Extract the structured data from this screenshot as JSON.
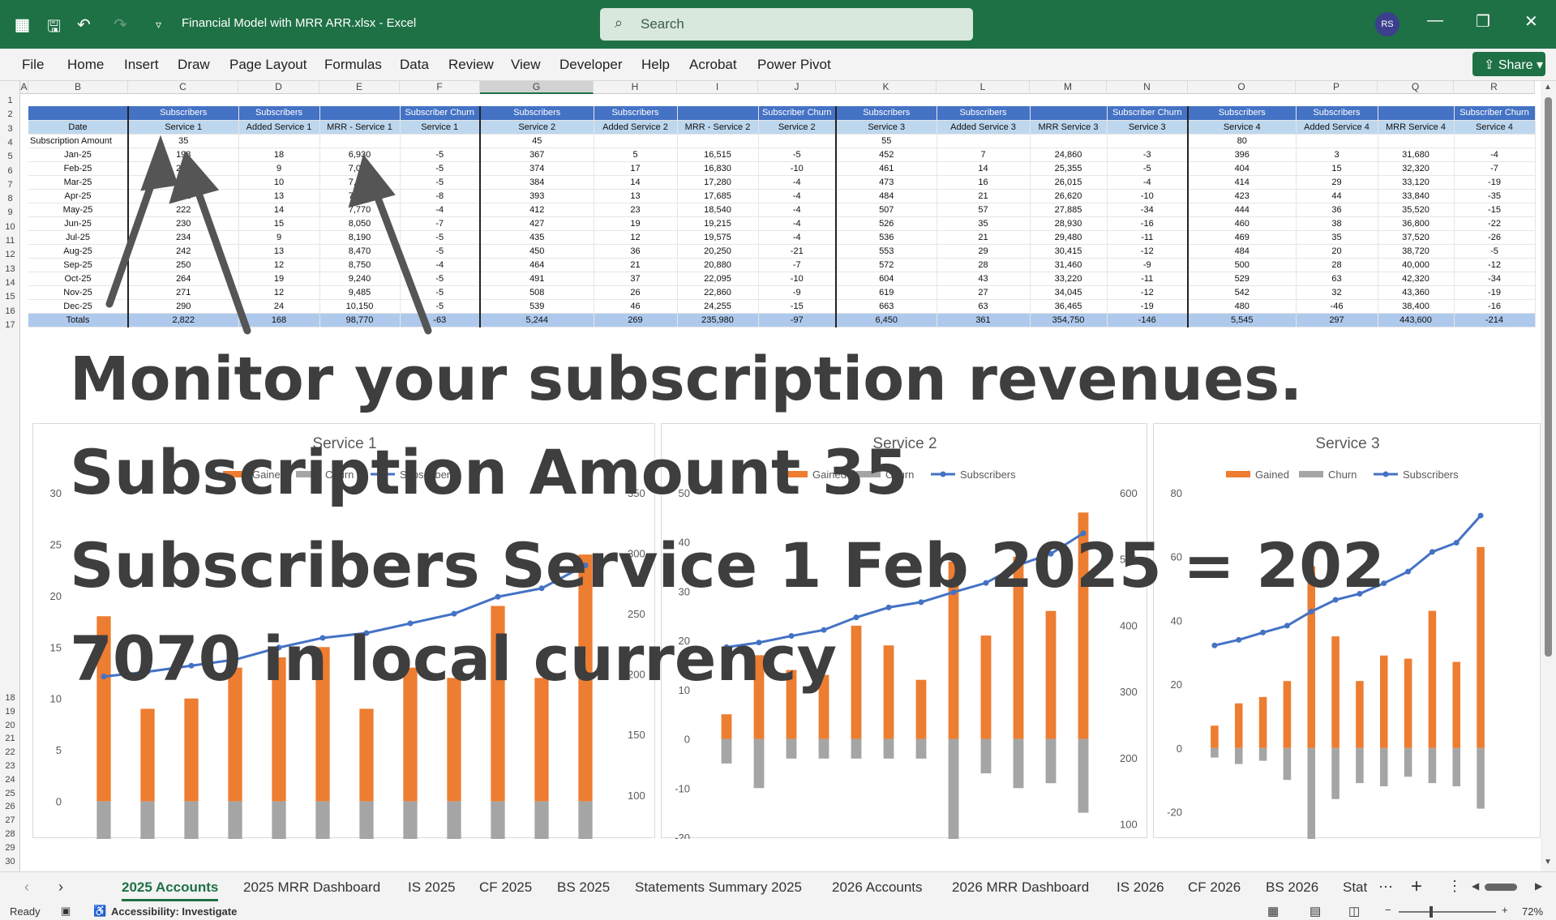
{
  "titlebar": {
    "filename": "Financial Model with MRR ARR.xlsx",
    "app": "Excel",
    "search_placeholder": "Search",
    "avatar_initials": "RS"
  },
  "ribbon": {
    "menu": [
      "File",
      "Home",
      "Insert",
      "Draw",
      "Page Layout",
      "Formulas",
      "Data",
      "Review",
      "View",
      "Developer",
      "Help",
      "Acrobat",
      "Power Pivot"
    ],
    "share_label": "Share"
  },
  "sheet": {
    "columns": [
      "A",
      "B",
      "C",
      "D",
      "E",
      "F",
      "G",
      "H",
      "I",
      "J",
      "K",
      "L",
      "M",
      "N",
      "O",
      "P",
      "Q",
      "R"
    ],
    "header_row1": [
      "",
      "Subscribers",
      "Subscribers",
      "",
      "Subscriber Churn",
      "Subscribers",
      "Subscribers",
      "",
      "Subscriber Churn",
      "Subscribers",
      "Subscribers",
      "",
      "Subscriber Churn",
      "Subscribers",
      "Subscribers",
      "",
      "Subscriber Churn"
    ],
    "header_row2": [
      "Date",
      "Service 1",
      "Added Service 1",
      "MRR - Service 1",
      "Service 1",
      "Service 2",
      "Added Service 2",
      "MRR - Service 2",
      "Service 2",
      "Service 3",
      "Added Service 3",
      "MRR  Service 3",
      "Service 3",
      "Service 4",
      "Added Service 4",
      "MRR Service 4",
      "Service 4"
    ],
    "subscription_row": [
      "Subscription Amount",
      "35",
      "",
      "",
      "",
      "45",
      "",
      "",
      "",
      "55",
      "",
      "",
      "",
      "80",
      "",
      "",
      ""
    ],
    "rows": [
      [
        "Jan-25",
        "198",
        "18",
        "6,930",
        "-5",
        "367",
        "5",
        "16,515",
        "-5",
        "452",
        "7",
        "24,860",
        "-3",
        "396",
        "3",
        "31,680",
        "-4"
      ],
      [
        "Feb-25",
        "202",
        "9",
        "7,070",
        "-5",
        "374",
        "17",
        "16,830",
        "-10",
        "461",
        "14",
        "25,355",
        "-5",
        "404",
        "15",
        "32,320",
        "-7"
      ],
      [
        "Mar-25",
        "207",
        "10",
        "7,245",
        "-5",
        "384",
        "14",
        "17,280",
        "-4",
        "473",
        "16",
        "26,015",
        "-4",
        "414",
        "29",
        "33,120",
        "-19"
      ],
      [
        "Apr-25",
        "212",
        "13",
        "7,420",
        "-8",
        "393",
        "13",
        "17,685",
        "-4",
        "484",
        "21",
        "26,620",
        "-10",
        "423",
        "44",
        "33,840",
        "-35"
      ],
      [
        "May-25",
        "222",
        "14",
        "7,770",
        "-4",
        "412",
        "23",
        "18,540",
        "-4",
        "507",
        "57",
        "27,885",
        "-34",
        "444",
        "36",
        "35,520",
        "-15"
      ],
      [
        "Jun-25",
        "230",
        "15",
        "8,050",
        "-7",
        "427",
        "19",
        "19,215",
        "-4",
        "526",
        "35",
        "28,930",
        "-16",
        "460",
        "38",
        "36,800",
        "-22"
      ],
      [
        "Jul-25",
        "234",
        "9",
        "8,190",
        "-5",
        "435",
        "12",
        "19,575",
        "-4",
        "536",
        "21",
        "29,480",
        "-11",
        "469",
        "35",
        "37,520",
        "-26"
      ],
      [
        "Aug-25",
        "242",
        "13",
        "8,470",
        "-5",
        "450",
        "36",
        "20,250",
        "-21",
        "553",
        "29",
        "30,415",
        "-12",
        "484",
        "20",
        "38,720",
        "-5"
      ],
      [
        "Sep-25",
        "250",
        "12",
        "8,750",
        "-4",
        "464",
        "21",
        "20,880",
        "-7",
        "572",
        "28",
        "31,460",
        "-9",
        "500",
        "28",
        "40,000",
        "-12"
      ],
      [
        "Oct-25",
        "264",
        "19",
        "9,240",
        "-5",
        "491",
        "37",
        "22,095",
        "-10",
        "604",
        "43",
        "33,220",
        "-11",
        "529",
        "63",
        "42,320",
        "-34"
      ],
      [
        "Nov-25",
        "271",
        "12",
        "9,485",
        "-5",
        "508",
        "26",
        "22,860",
        "-9",
        "619",
        "27",
        "34,045",
        "-12",
        "542",
        "32",
        "43,360",
        "-19"
      ],
      [
        "Dec-25",
        "290",
        "24",
        "10,150",
        "-5",
        "539",
        "46",
        "24,255",
        "-15",
        "663",
        "63",
        "36,465",
        "-19",
        "480",
        "-46",
        "38,400",
        "-16"
      ]
    ],
    "totals": [
      "Totals",
      "2,822",
      "168",
      "98,770",
      "-63",
      "5,244",
      "269",
      "235,980",
      "-97",
      "6,450",
      "361",
      "354,750",
      "-146",
      "5,545",
      "297",
      "443,600",
      "-214"
    ]
  },
  "overlay": {
    "line1": "Monitor your subscription revenues.",
    "line2": "Subscription Amount 35",
    "line3": "Subscribers Service 1 Feb 2025 = 202",
    "line4": "7070 in local currency"
  },
  "chart_data": [
    {
      "type": "bar",
      "title": "Service 1",
      "legend": [
        "Gained",
        "Churn",
        "Subscribers"
      ],
      "legend_position": "top",
      "ylim": [
        -3.5,
        30
      ],
      "y2lim": [
        65,
        350
      ],
      "yticks": [
        0,
        5,
        10,
        15,
        20,
        25,
        30
      ],
      "y2ticks": [
        100,
        150,
        200,
        250,
        300,
        350
      ],
      "series": [
        {
          "name": "Gained",
          "values": [
            18,
            9,
            10,
            13,
            14,
            15,
            9,
            13,
            12,
            19,
            12,
            24
          ],
          "color": "#ed7d31"
        },
        {
          "name": "Churn",
          "values": [
            -5,
            -5,
            -5,
            -8,
            -4,
            -7,
            -5,
            -5,
            -4,
            -5,
            -5,
            -5
          ],
          "color": "#a5a5a5"
        },
        {
          "name": "Subscribers",
          "values": [
            198,
            202,
            207,
            212,
            222,
            230,
            234,
            242,
            250,
            264,
            271,
            290
          ],
          "color": "#4472c4",
          "axis": "secondary"
        }
      ]
    },
    {
      "type": "bar",
      "title": "Service 2",
      "legend": [
        "Gained",
        "Churn",
        "Subscribers"
      ],
      "legend_position": "top",
      "ylim": [
        -20,
        50
      ],
      "y2lim": [
        80,
        600
      ],
      "yticks": [
        -20,
        -10,
        0,
        10,
        20,
        30,
        40,
        50
      ],
      "y2ticks": [
        100,
        200,
        300,
        400,
        500,
        600
      ],
      "series": [
        {
          "name": "Gained",
          "values": [
            5,
            17,
            14,
            13,
            23,
            19,
            12,
            36,
            21,
            37,
            26,
            46
          ],
          "color": "#ed7d31"
        },
        {
          "name": "Churn",
          "values": [
            -5,
            -10,
            -4,
            -4,
            -4,
            -4,
            -4,
            -21,
            -7,
            -10,
            -9,
            -15
          ],
          "color": "#a5a5a5"
        },
        {
          "name": "Subscribers",
          "values": [
            367,
            374,
            384,
            393,
            412,
            427,
            435,
            450,
            464,
            491,
            508,
            539
          ],
          "color": "#4472c4",
          "axis": "secondary"
        }
      ]
    },
    {
      "type": "bar",
      "title": "Service 3",
      "legend": [
        "Gained",
        "Churn",
        "Subscribers"
      ],
      "legend_position": "top",
      "ylim": [
        -28,
        80
      ],
      "y2lim": [
        140,
        700
      ],
      "yticks": [
        -20,
        0,
        20,
        40,
        60,
        80
      ],
      "series": [
        {
          "name": "Gained",
          "values": [
            7,
            14,
            16,
            21,
            57,
            35,
            21,
            29,
            28,
            43,
            27,
            63
          ],
          "color": "#ed7d31"
        },
        {
          "name": "Churn",
          "values": [
            -3,
            -5,
            -4,
            -10,
            -34,
            -16,
            -11,
            -12,
            -9,
            -11,
            -12,
            -19
          ],
          "color": "#a5a5a5"
        },
        {
          "name": "Subscribers",
          "values": [
            452,
            461,
            473,
            484,
            507,
            526,
            536,
            553,
            572,
            604,
            619,
            663
          ],
          "color": "#4472c4",
          "axis": "secondary"
        }
      ]
    }
  ],
  "sheet_tabs": [
    "2025 Accounts",
    "2025 MRR Dashboard",
    "IS 2025",
    "CF 2025",
    "BS 2025",
    "Statements Summary 2025",
    "2026 Accounts",
    "2026 MRR Dashboard",
    "IS 2026",
    "CF 2026",
    "BS 2026",
    "Stat"
  ],
  "status": {
    "ready": "Ready",
    "accessibility": "Accessibility: Investigate",
    "zoom": "72%"
  }
}
